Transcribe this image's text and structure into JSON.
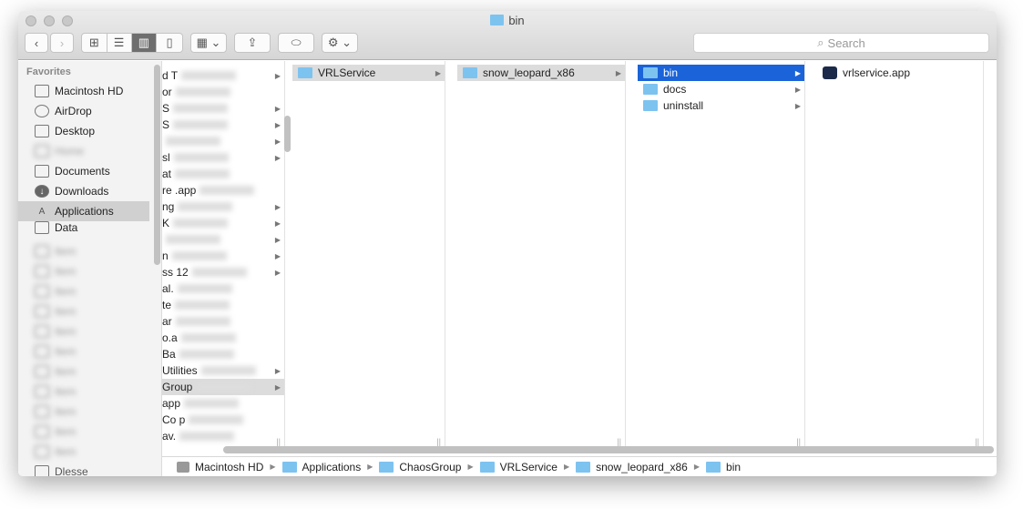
{
  "window": {
    "title": "bin"
  },
  "toolbar": {
    "back": "‹",
    "forward": "›",
    "search_placeholder": "Search"
  },
  "sidebar": {
    "heading": "Favorites",
    "items": [
      {
        "label": "Macintosh HD",
        "icon": "hard-drive-icon"
      },
      {
        "label": "AirDrop",
        "icon": "airdrop-icon"
      },
      {
        "label": "Desktop",
        "icon": "desktop-icon"
      },
      {
        "label": "Home",
        "icon": "home-icon"
      },
      {
        "label": "Documents",
        "icon": "documents-icon"
      },
      {
        "label": "Downloads",
        "icon": "downloads-icon"
      },
      {
        "label": "Applications",
        "icon": "applications-icon",
        "selected": true
      },
      {
        "label": "Data",
        "icon": "folder-icon"
      }
    ],
    "hidden_items": [
      "Item",
      "Item",
      "Item",
      "Item",
      "Item",
      "Item",
      "Item",
      "Item",
      "Item",
      "Item",
      "Item",
      "Item"
    ],
    "last": "Dlesse"
  },
  "columns": {
    "c1": [
      {
        "t": "d T",
        "a": true
      },
      {
        "t": "or",
        "a": false
      },
      {
        "t": "S",
        "a": true
      },
      {
        "t": "S",
        "a": true
      },
      {
        "t": "",
        "a": true
      },
      {
        "t": "sl",
        "a": true
      },
      {
        "t": "at",
        "a": false
      },
      {
        "t": "re .app",
        "a": false
      },
      {
        "t": "ng",
        "a": true
      },
      {
        "t": "K",
        "a": true
      },
      {
        "t": "",
        "a": true
      },
      {
        "t": "n",
        "a": true
      },
      {
        "t": "ss 12",
        "a": true
      },
      {
        "t": "al.",
        "a": false
      },
      {
        "t": "te",
        "a": false
      },
      {
        "t": "ar",
        "a": false
      },
      {
        "t": "o.a",
        "a": false
      },
      {
        "t": "Ba",
        "a": false
      },
      {
        "t": "Utilities",
        "a": true
      },
      {
        "t": "Group",
        "a": true,
        "sel": true
      },
      {
        "t": "app",
        "a": false
      },
      {
        "t": "Co p",
        "a": false
      },
      {
        "t": "av.",
        "a": false
      }
    ],
    "c2": [
      {
        "t": "VRLService"
      }
    ],
    "c3": [
      {
        "t": "snow_leopard_x86"
      }
    ],
    "c4": [
      {
        "t": "bin"
      },
      {
        "t": "docs"
      },
      {
        "t": "uninstall"
      }
    ],
    "c5": [
      {
        "t": "vrlservice.app"
      }
    ]
  },
  "pathbar": [
    "Macintosh HD",
    "Applications",
    "ChaosGroup",
    "VRLService",
    "snow_leopard_x86",
    "bin"
  ],
  "colors": {
    "selection": "#1b63d8",
    "folder": "#7dc3f0",
    "inactive_selection": "#dcdcdc"
  }
}
